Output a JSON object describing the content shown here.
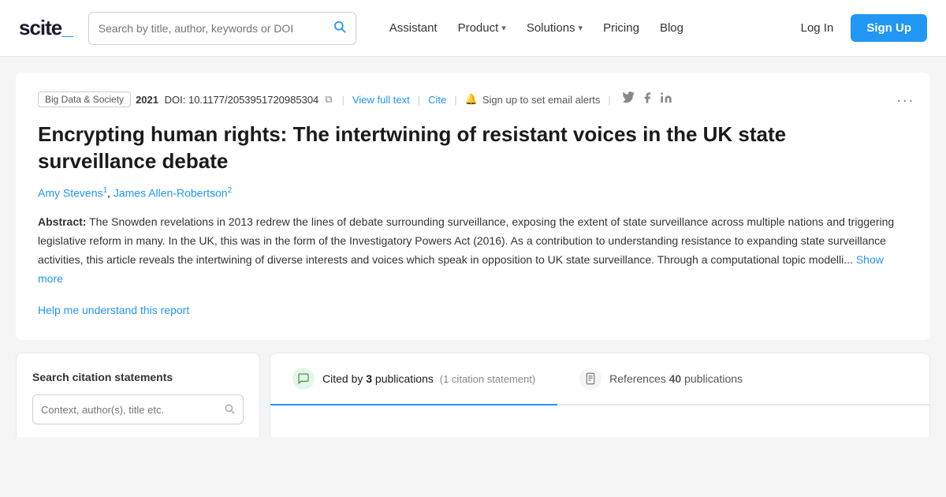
{
  "header": {
    "logo_text": "scite_",
    "search_placeholder": "Search by title, author, keywords or DOI",
    "nav_items": [
      {
        "label": "Assistant",
        "has_chevron": false
      },
      {
        "label": "Product",
        "has_chevron": true
      },
      {
        "label": "Solutions",
        "has_chevron": true
      },
      {
        "label": "Pricing",
        "has_chevron": false
      },
      {
        "label": "Blog",
        "has_chevron": false
      }
    ],
    "login_label": "Log In",
    "signup_label": "Sign Up"
  },
  "paper": {
    "journal": "Big Data & Society",
    "year": "2021",
    "doi_label": "DOI:",
    "doi_value": "10.1177/20539517209853​04",
    "view_full_label": "View full text",
    "cite_label": "Cite",
    "alert_text": "Sign up to set email alerts",
    "more_icon": "...",
    "title": "Encrypting human rights: The intertwining of resistant voices in the UK state surveillance debate",
    "authors": [
      {
        "name": "Amy Stevens",
        "sup": "1"
      },
      {
        "name": "James Allen-Robertson",
        "sup": "2"
      }
    ],
    "abstract_label": "Abstract:",
    "abstract_text": " The Snowden revelations in 2013 redrew the lines of debate surrounding surveillance, exposing the extent of state surveillance across multiple nations and triggering legislative reform in many. In the UK, this was in the form of the Investigatory Powers Act (2016). As a contribution to understanding resistance to expanding state surveillance activities, this article reveals the intertwining of diverse interests and voices which speak in opposition to UK state surveillance. Through a computational topic modelli...",
    "show_more_label": "Show more",
    "help_link_label": "Help me understand this report"
  },
  "citation_search": {
    "title": "Search citation statements",
    "placeholder": "Context, author(s), title etc."
  },
  "tabs": [
    {
      "icon_type": "green",
      "icon_char": "💬",
      "label_prefix": "Cited by ",
      "count": "3",
      "label_suffix": " publications",
      "sub": "(1 citation statement)",
      "active": true
    },
    {
      "icon_type": "gray",
      "icon_char": "📋",
      "label_prefix": "References ",
      "count": "40",
      "label_suffix": " publications",
      "sub": "",
      "active": false
    }
  ],
  "colors": {
    "accent": "#2196f3",
    "green": "#43a047",
    "text_dark": "#1a1a1a",
    "text_mid": "#333",
    "text_light": "#888"
  }
}
